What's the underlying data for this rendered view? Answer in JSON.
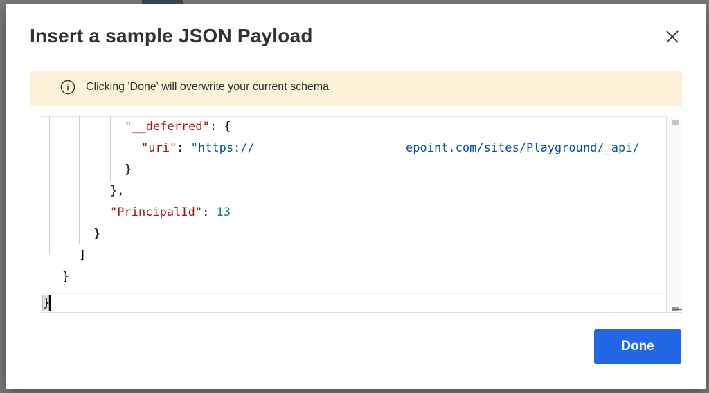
{
  "dialog": {
    "title": "Insert a sample JSON Payload",
    "close_icon": "close-icon"
  },
  "banner": {
    "icon": "info-icon",
    "message": "Clicking 'Done' will overwrite your current schema",
    "background": "#fcf2d8"
  },
  "editor": {
    "lines": {
      "l1_key": "\"__deferred\"",
      "l1_rest": ": {",
      "l2_key": "\"uri\"",
      "l2_colon": ": ",
      "l2_val_start": "\"https://",
      "l2_val_end": "epoint.com/sites/Playground/_api/",
      "l3": "}",
      "l4": "},",
      "l5_key": "\"PrincipalId\"",
      "l5_colon": ": ",
      "l5_val": "13",
      "l6": "}",
      "l7": "]",
      "l8": "}",
      "l9": "}"
    },
    "colors": {
      "key": "#a31515",
      "string": "#0451a5",
      "number": "#098658"
    }
  },
  "footer": {
    "done_label": "Done",
    "done_color": "#2266e3"
  }
}
